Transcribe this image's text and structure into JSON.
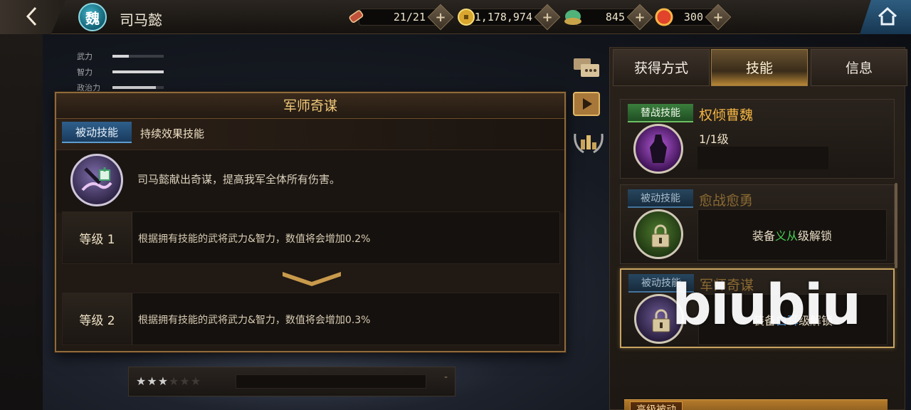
{
  "hero": {
    "faction": "魏",
    "name": "司马懿"
  },
  "resources": [
    {
      "icon": "scroll-icon",
      "value": "21/21"
    },
    {
      "icon": "coin-icon",
      "value": "1,178,974"
    },
    {
      "icon": "jade-icon",
      "value": "845"
    },
    {
      "icon": "gem-icon",
      "value": "300"
    }
  ],
  "stats": [
    {
      "label": "武力",
      "fill": 0.32
    },
    {
      "label": "智力",
      "fill": 1.0
    },
    {
      "label": "政治力",
      "fill": 0.85
    }
  ],
  "dialog": {
    "title": "军师奇谋",
    "type_badge": "被动技能",
    "type_text": "持续效果技能",
    "description": "司马懿献出奇谋，提高我军全体所有伤害。",
    "levels": [
      {
        "label": "等级 1",
        "text": "根据拥有技能的武将武力&智力，数值将会增加0.2%"
      },
      {
        "label": "等级 2",
        "text": "根据拥有技能的武将武力&智力，数值将会增加0.3%"
      }
    ]
  },
  "star_bar": {
    "stars_filled": 3,
    "stars_total": 6,
    "symbol": "-"
  },
  "tabs": [
    {
      "label": "获得方式"
    },
    {
      "label": "技能",
      "active": true
    },
    {
      "label": "信息"
    }
  ],
  "skills": [
    {
      "tag": "替战技能",
      "name": "权倾曹魏",
      "level": "1/1级"
    },
    {
      "tag": "被动技能",
      "name": "愈战愈勇",
      "unlock_pre": "装备",
      "unlock_item": "义从",
      "unlock_post": "级解锁"
    },
    {
      "tag": "被动技能",
      "name": "军师奇谋",
      "unlock_pre": "装备",
      "unlock_item": "白耳",
      "unlock_post": "级解锁"
    }
  ],
  "advanced": {
    "tag": "高级被动"
  },
  "watermark": "biubiu",
  "colors": {
    "gold": "#f2b543",
    "panel_border": "#8f6a3a",
    "green_tag": "#3a7e3d",
    "blue_tag": "#2e5f8c"
  }
}
